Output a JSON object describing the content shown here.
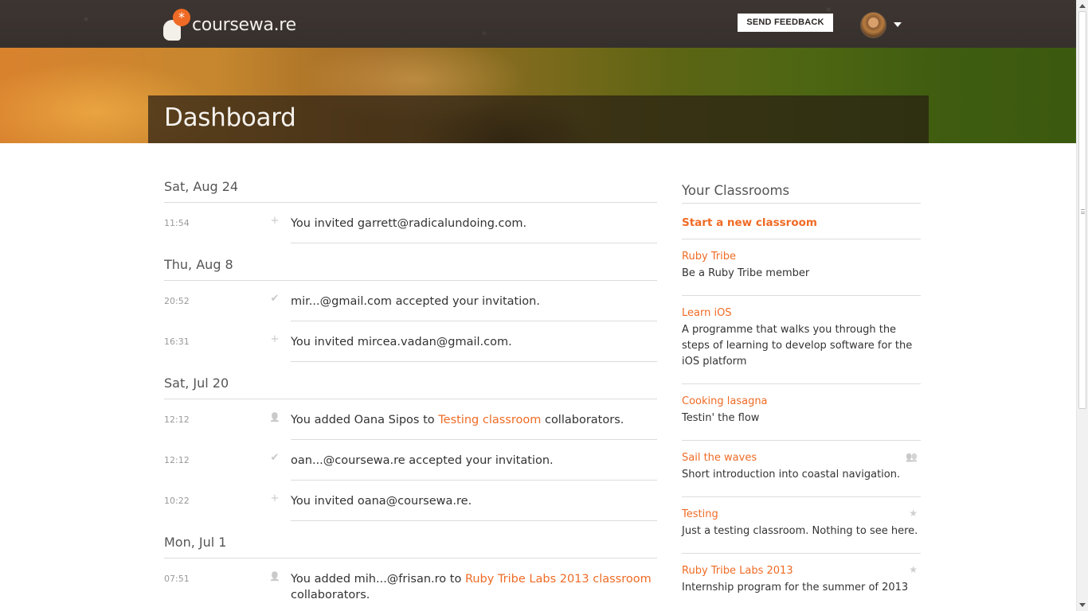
{
  "header": {
    "logo_text": "coursewa.re",
    "logo_star": "*",
    "feedback_label": "SEND FEEDBACK"
  },
  "hero": {
    "title": "Dashboard"
  },
  "feed": {
    "days": [
      {
        "date": "Sat, Aug 24",
        "entries": [
          {
            "time": "11:54",
            "icon": "plus-icon",
            "glyph": "+",
            "text": "You invited garrett@radicalundoing.com."
          }
        ]
      },
      {
        "date": "Thu, Aug 8",
        "entries": [
          {
            "time": "20:52",
            "icon": "check-icon",
            "glyph": "✔",
            "text": "mir...@gmail.com accepted your invitation."
          },
          {
            "time": "16:31",
            "icon": "plus-icon",
            "glyph": "+",
            "text": "You invited mircea.vadan@gmail.com."
          }
        ]
      },
      {
        "date": "Sat, Jul 20",
        "entries": [
          {
            "time": "12:12",
            "icon": "add-user-icon",
            "glyph": "👤",
            "pre": "You added Oana Sipos to ",
            "link": "Testing classroom",
            "post": " collaborators."
          },
          {
            "time": "12:12",
            "icon": "check-icon",
            "glyph": "✔",
            "text": "oan...@coursewa.re accepted your invitation."
          },
          {
            "time": "10:22",
            "icon": "plus-icon",
            "glyph": "+",
            "text": "You invited oana@coursewa.re."
          }
        ]
      },
      {
        "date": "Mon, Jul 1",
        "entries": [
          {
            "time": "07:51",
            "icon": "add-user-icon",
            "glyph": "👤",
            "pre": "You added mih...@frisan.ro to ",
            "link": "Ruby Tribe Labs 2013 classroom",
            "post": " collaborators."
          }
        ]
      }
    ]
  },
  "sidebar": {
    "title": "Your Classrooms",
    "new_classroom_label": "Start a new classroom",
    "classrooms": [
      {
        "name": "Ruby Tribe",
        "description": "Be a Ruby Tribe member",
        "badge": ""
      },
      {
        "name": "Learn iOS",
        "description": "A programme that walks you through the steps of learning to develop software for the iOS platform",
        "badge": ""
      },
      {
        "name": "Cooking lasagna",
        "description": "Testin' the flow",
        "badge": ""
      },
      {
        "name": "Sail the waves",
        "description": "Short introduction into coastal navigation.",
        "badge": "collaborators-icon"
      },
      {
        "name": "Testing",
        "description": "Just a testing classroom. Nothing to see here.",
        "badge": "star-icon"
      },
      {
        "name": "Ruby Tribe Labs 2013",
        "description": "Internship program for the summer of 2013",
        "badge": "star-icon"
      }
    ]
  },
  "colors": {
    "accent": "#ef6b25",
    "topbar": "#3a332f",
    "text": "#333333"
  }
}
